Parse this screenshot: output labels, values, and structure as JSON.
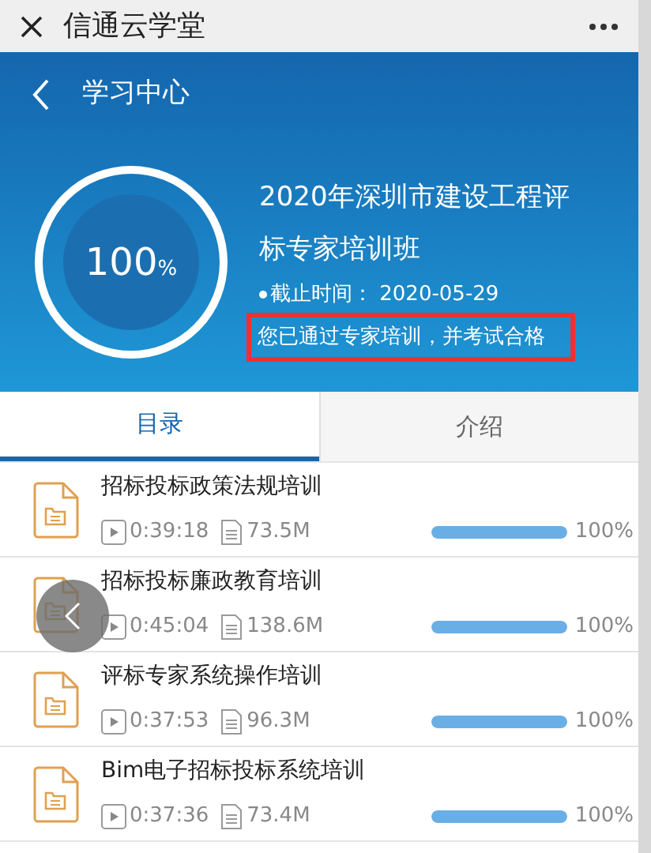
{
  "app_bar": {
    "title": "信通云学堂"
  },
  "header": {
    "title": "学习中心",
    "progress": "100",
    "progress_unit": "%",
    "course_title": "2020年深圳市建设工程评标专家培训班",
    "deadline_label": "截止时间：",
    "deadline": "2020-05-29",
    "status": "您已通过专家培训，并考试合格",
    "status_highlighted": true
  },
  "tabs": [
    {
      "label": "目录",
      "selected": true
    },
    {
      "label": "介绍",
      "selected": false
    }
  ],
  "lessons": [
    {
      "title": "招标投标政策法规培训",
      "duration": "0:39:18",
      "size": "73.5M",
      "level": 1,
      "percent": "100%"
    },
    {
      "title": "招标投标廉政教育培训",
      "duration": "0:45:04",
      "size": "138.6M",
      "level": 1,
      "percent": "100%"
    },
    {
      "title": "评标专家系统操作培训",
      "duration": "0:37:53",
      "size": "96.3M",
      "level": 1,
      "percent": "100%"
    },
    {
      "title": "Bim电子招标投标系统培训",
      "duration": "0:37:36",
      "size": "73.4M",
      "level": 1,
      "percent": "100%"
    }
  ]
}
